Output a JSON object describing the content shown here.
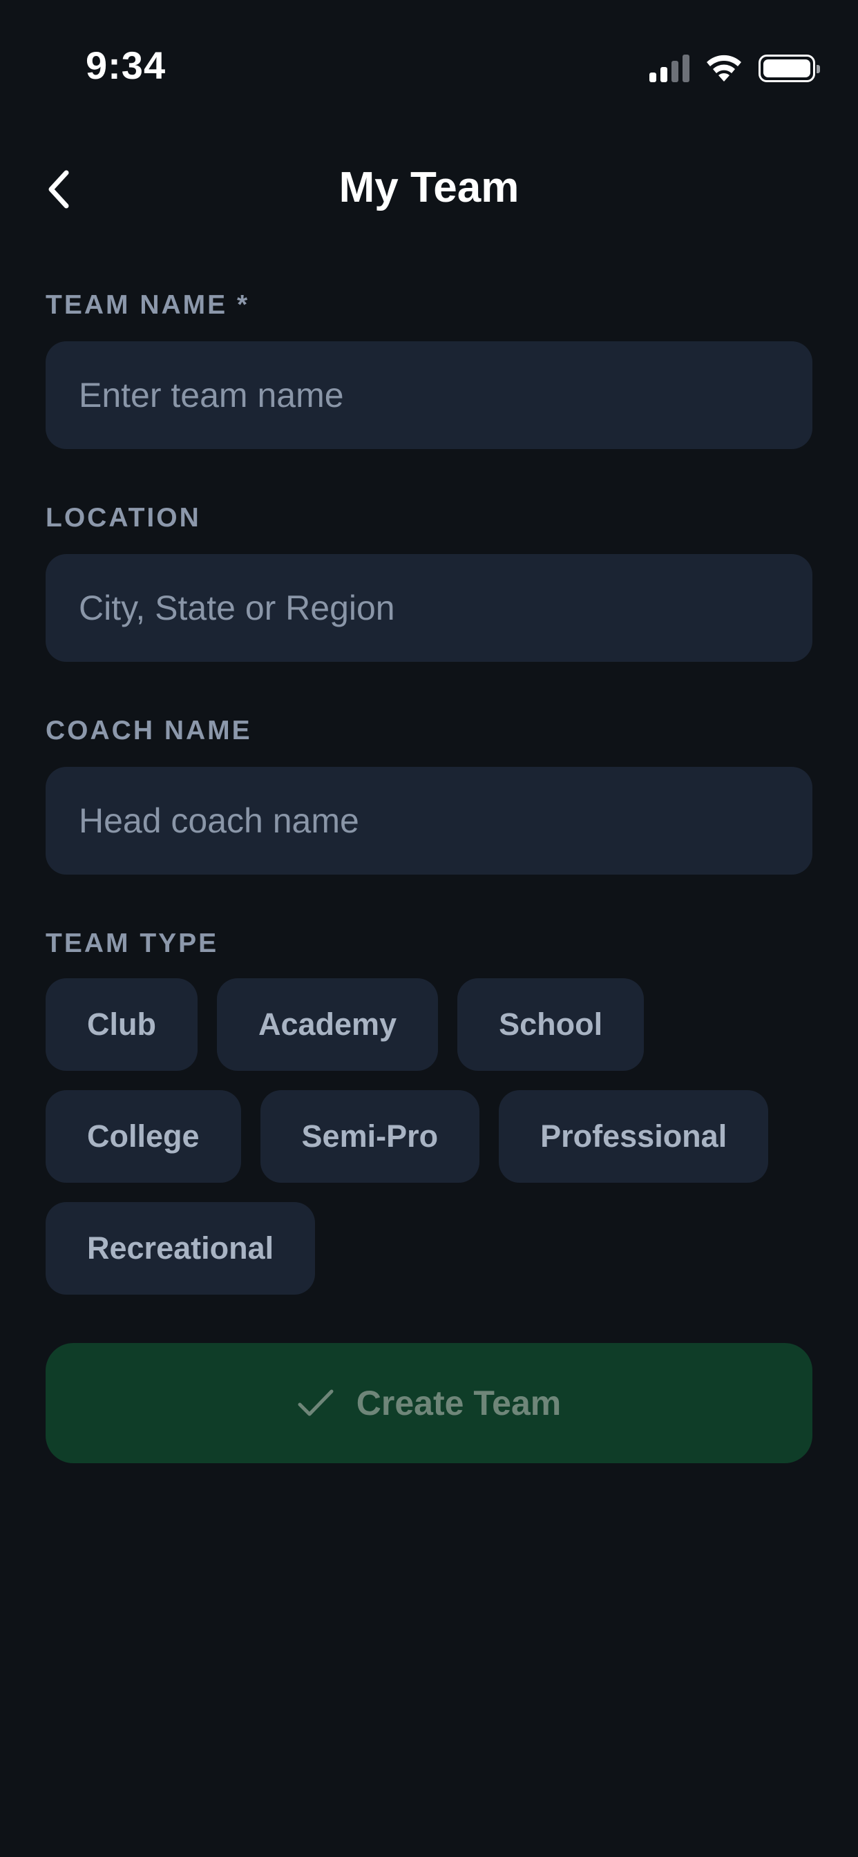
{
  "status_bar": {
    "time": "9:34"
  },
  "header": {
    "title": "My Team",
    "back_icon": "chevron-left-icon"
  },
  "form": {
    "team_name": {
      "label": "TEAM NAME *",
      "placeholder": "Enter team name",
      "value": ""
    },
    "location": {
      "label": "LOCATION",
      "placeholder": "City, State or Region",
      "value": ""
    },
    "coach_name": {
      "label": "COACH NAME",
      "placeholder": "Head coach name",
      "value": ""
    },
    "team_type": {
      "label": "TEAM TYPE",
      "options": [
        "Club",
        "Academy",
        "School",
        "College",
        "Semi-Pro",
        "Professional",
        "Recreational"
      ]
    }
  },
  "actions": {
    "create_label": "Create Team",
    "create_icon": "checkmark-icon"
  },
  "colors": {
    "background": "#0e1217",
    "input_background": "#1b2433",
    "label": "#8c98ab",
    "button_background": "#0f3d28",
    "button_text": "#6f8679"
  }
}
